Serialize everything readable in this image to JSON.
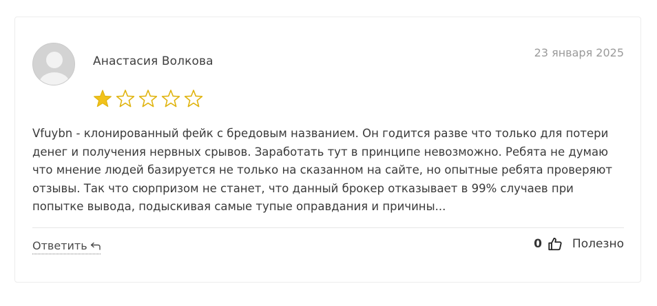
{
  "review": {
    "author": "Анастасия Волкова",
    "date": "23 января 2025",
    "rating": 1,
    "max_rating": 5,
    "text": "Vfuybn - клонированный фейк с бредовым названием. Он годится разве что только для потери денег и получения нервных срывов. Заработать тут в принципе невозможно. Ребята не думаю что мнение людей базируется не только на сказанном на сайте, но опытные ребята проверяют отзывы. Так что сюрпризом не станет, что данный брокер отказывает в 99% случаев при попытке вывода, подыскивая самые тупые оправдания и причины..."
  },
  "actions": {
    "reply_label": "Ответить",
    "helpful_count": "0",
    "helpful_label": "Полезно"
  },
  "colors": {
    "star_filled": "#f2c21b",
    "star_empty_stroke": "#e0b40f",
    "avatar_bg": "#d3d3d3"
  },
  "icons": {
    "avatar": "user-placeholder-icon",
    "star": "star-icon",
    "reply": "reply-arrow-icon",
    "helpful": "thumbs-up-icon"
  }
}
